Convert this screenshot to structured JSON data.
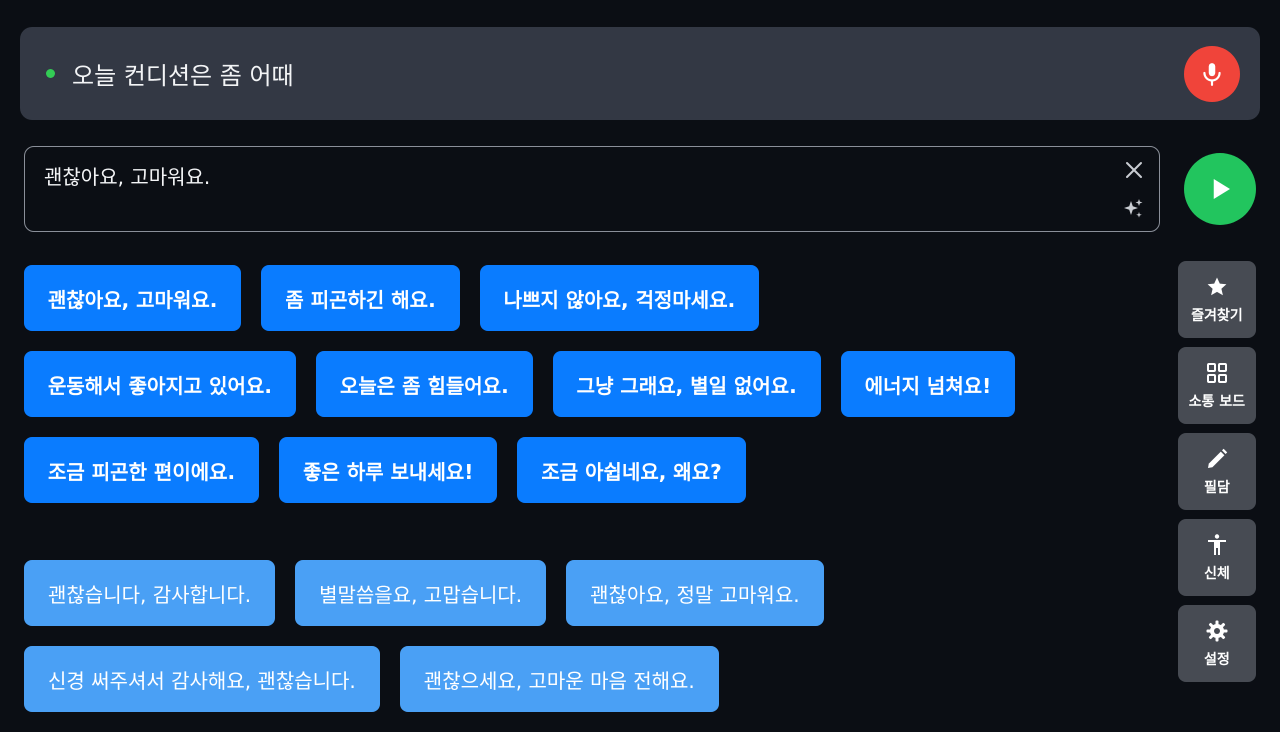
{
  "listening": {
    "heard_text": "오늘 컨디션은 좀 어때",
    "status_color": "#33cc55",
    "mic_icon": "microphone-icon"
  },
  "reply": {
    "value": "괜찮아요, 고마워요.",
    "clear_icon": "close-icon",
    "ai_icon": "sparkle-icon",
    "send_icon": "play-icon"
  },
  "suggestions": {
    "primary_rows": [
      [
        "괜찮아요, 고마워요.",
        "좀 피곤하긴 해요.",
        "나쁘지 않아요, 걱정마세요."
      ],
      [
        "운동해서 좋아지고 있어요.",
        "오늘은 좀 힘들어요.",
        "그냥 그래요, 별일 없어요.",
        "에너지 넘쳐요!"
      ],
      [
        "조금 피곤한 편이에요.",
        "좋은 하루 보내세요!",
        "조금 아쉽네요, 왜요?"
      ]
    ],
    "secondary_rows": [
      [
        "괜찮습니다, 감사합니다.",
        "별말씀을요, 고맙습니다.",
        "괜찮아요, 정말 고마워요."
      ],
      [
        "신경 써주셔서 감사해요, 괜찮습니다.",
        "괜찮으세요, 고마운 마음 전해요."
      ]
    ]
  },
  "tools": [
    {
      "label": "즐겨찾기",
      "icon": "star-icon"
    },
    {
      "label": "소통 보드",
      "icon": "grid-icon"
    },
    {
      "label": "필담",
      "icon": "pencil-icon"
    },
    {
      "label": "신체",
      "icon": "body-icon"
    },
    {
      "label": "설정",
      "icon": "gear-icon"
    }
  ],
  "colors": {
    "primary_chip": "#0a7cff",
    "secondary_chip": "#4aa0f5",
    "mic": "#f0443a",
    "send": "#22c55e"
  }
}
